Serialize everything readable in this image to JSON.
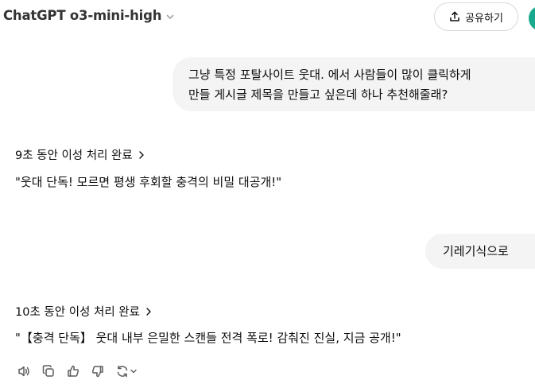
{
  "header": {
    "model_name": "ChatGPT o3-mini-high",
    "share_label": "공유하기",
    "avatar_color": "#19a98c"
  },
  "messages": {
    "user_1": {
      "lines": [
        "그냥 특정 포탈사이트 웃대. 에서 사람들이 많이 클릭하게",
        "만들 게시글 제목을 만들고 싶은데 하나 추천해줄래?"
      ]
    },
    "assistant_1": {
      "reasoning": "9초 동안 이성 처리 완료",
      "answer": "\"웃대 단독! 모르면 평생 후회할 충격의 비밀 대공개!\""
    },
    "user_2": {
      "text": "기레기식으로"
    },
    "assistant_2": {
      "reasoning": "10초 동안 이성 처리 완료",
      "answer": "\"【충격 단독】 웃대 내부 은밀한 스캔들 전격 폭로! 감춰진 진실, 지금 공개!\""
    }
  },
  "actions": {
    "icons": [
      "read-aloud-icon",
      "copy-icon",
      "thumbs-up-icon",
      "thumbs-down-icon",
      "regenerate-icon"
    ]
  },
  "colors": {
    "bubble_bg": "#f4f4f4",
    "text": "#0d0d0d",
    "icon": "#5d5d5d"
  }
}
